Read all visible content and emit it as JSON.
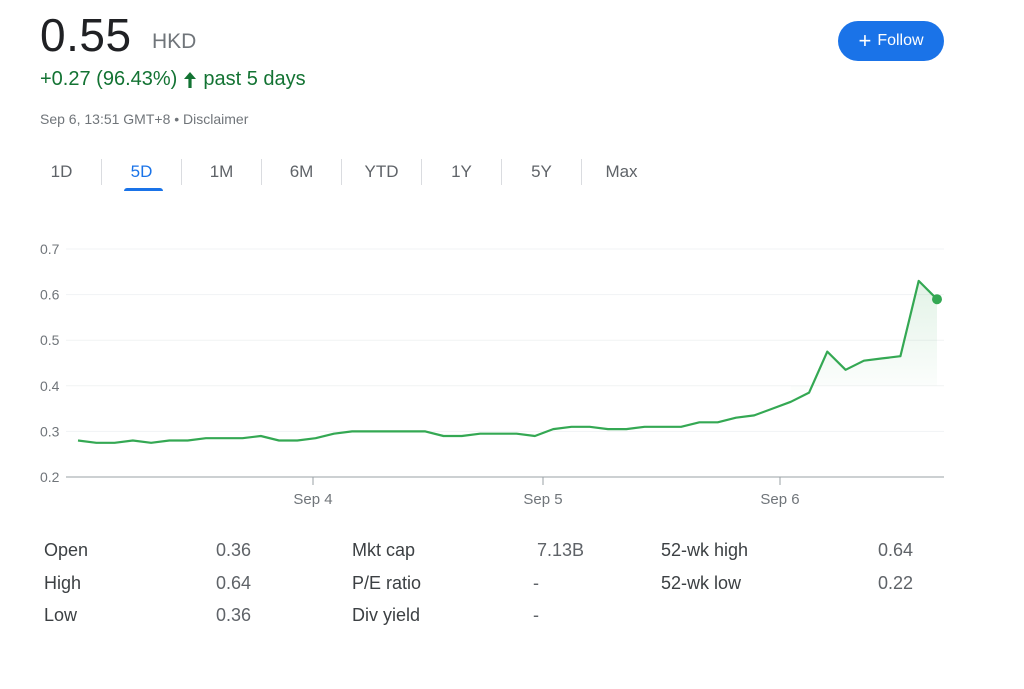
{
  "header": {
    "price": "0.55",
    "currency": "HKD",
    "change": "+0.27 (96.43%)",
    "period": "past 5 days",
    "timestamp": "Sep 6, 13:51 GMT+8",
    "separator": "•",
    "disclaimer": "Disclaimer",
    "follow_label": "Follow",
    "follow_icon": "+",
    "up_color": "#137333",
    "accent_color": "#1a73e8"
  },
  "tabs": [
    "1D",
    "5D",
    "1M",
    "6M",
    "YTD",
    "1Y",
    "5Y",
    "Max"
  ],
  "active_tab": "5D",
  "chart_data": {
    "type": "line",
    "x_ticks": [
      "Sep 4",
      "Sep 5",
      "Sep 6"
    ],
    "y_ticks": [
      "0.2",
      "0.3",
      "0.4",
      "0.5",
      "0.6",
      "0.7"
    ],
    "ylim": [
      0.2,
      0.7
    ],
    "grid": true,
    "line_color": "#34a853",
    "series": [
      {
        "values": [
          0.28,
          0.275,
          0.275,
          0.28,
          0.275,
          0.28,
          0.28,
          0.285,
          0.285,
          0.285,
          0.29,
          0.28,
          0.28,
          0.285,
          0.295,
          0.3,
          0.3,
          0.3,
          0.3,
          0.3,
          0.29,
          0.29,
          0.295,
          0.295,
          0.295,
          0.29,
          0.305,
          0.31,
          0.31,
          0.305,
          0.305,
          0.31,
          0.31,
          0.31,
          0.32,
          0.32,
          0.33,
          0.335,
          0.35,
          0.365,
          0.385,
          0.475,
          0.435,
          0.455,
          0.46,
          0.465,
          0.63,
          0.59
        ]
      }
    ]
  },
  "stats": {
    "col1": [
      {
        "label": "Open",
        "value": "0.36"
      },
      {
        "label": "High",
        "value": "0.64"
      },
      {
        "label": "Low",
        "value": "0.36"
      }
    ],
    "col2": [
      {
        "label": "Mkt cap",
        "value": "7.13B"
      },
      {
        "label": "P/E ratio",
        "value": "-"
      },
      {
        "label": "Div yield",
        "value": "-"
      }
    ],
    "col3": [
      {
        "label": "52-wk high",
        "value": "0.64"
      },
      {
        "label": "52-wk low",
        "value": "0.22"
      }
    ]
  }
}
